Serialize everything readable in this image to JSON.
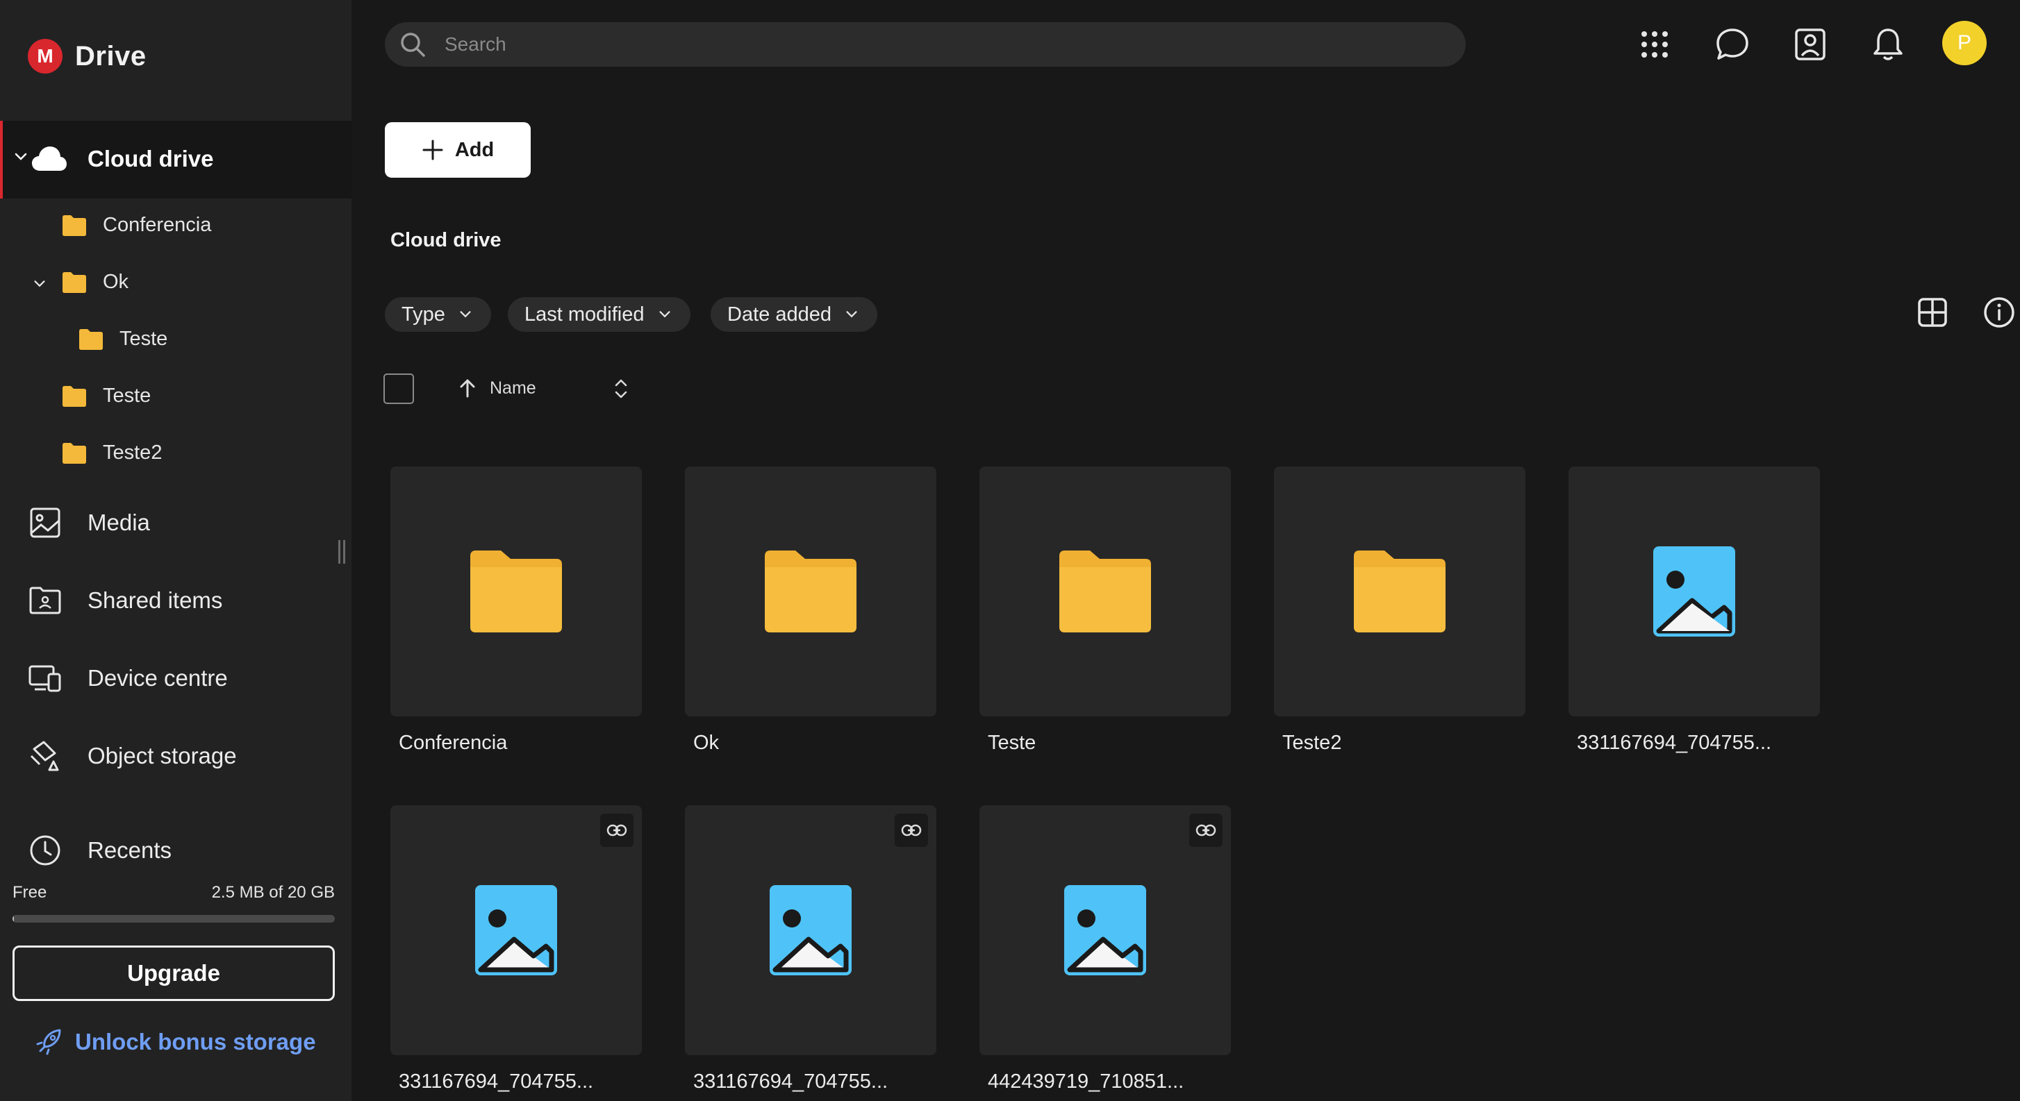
{
  "app": {
    "name": "Drive",
    "logo_letter": "M",
    "brand_color": "#d9272e"
  },
  "search": {
    "placeholder": "Search"
  },
  "user": {
    "avatar_initial": "P",
    "avatar_color": "#f2d12a"
  },
  "sidebar": {
    "active": {
      "label": "Cloud drive"
    },
    "tree": [
      {
        "label": "Conferencia"
      },
      {
        "label": "Ok"
      },
      {
        "label": "Teste"
      },
      {
        "label": "Teste"
      },
      {
        "label": "Teste2"
      }
    ],
    "nav": [
      {
        "label": "Media",
        "icon": "image-icon"
      },
      {
        "label": "Shared items",
        "icon": "shared-folder-icon"
      },
      {
        "label": "Device centre",
        "icon": "devices-icon"
      },
      {
        "label": "Object storage",
        "icon": "bucket-icon"
      },
      {
        "label": "Recents",
        "icon": "clock-icon"
      }
    ],
    "storage": {
      "plan": "Free",
      "usage": "2.5 MB of 20 GB",
      "used_fraction": 0.000125
    },
    "upgrade_label": "Upgrade",
    "unlock_label": "Unlock bonus storage",
    "unlock_color": "#6f9ef4"
  },
  "main": {
    "add_label": "Add",
    "title": "Cloud drive",
    "filters": [
      {
        "label": "Type"
      },
      {
        "label": "Last modified"
      },
      {
        "label": "Date added"
      }
    ],
    "sort": {
      "label": "Name"
    },
    "items": [
      {
        "name": "Conferencia",
        "kind": "folder",
        "linked": false
      },
      {
        "name": "Ok",
        "kind": "folder",
        "linked": false
      },
      {
        "name": "Teste",
        "kind": "folder",
        "linked": false
      },
      {
        "name": "Teste2",
        "kind": "folder",
        "linked": false
      },
      {
        "name": "331167694_704755...",
        "kind": "image",
        "linked": false
      },
      {
        "name": "331167694_704755...",
        "kind": "image",
        "linked": true
      },
      {
        "name": "331167694_704755...",
        "kind": "image",
        "linked": true
      },
      {
        "name": "442439719_710851...",
        "kind": "image",
        "linked": true
      }
    ]
  }
}
